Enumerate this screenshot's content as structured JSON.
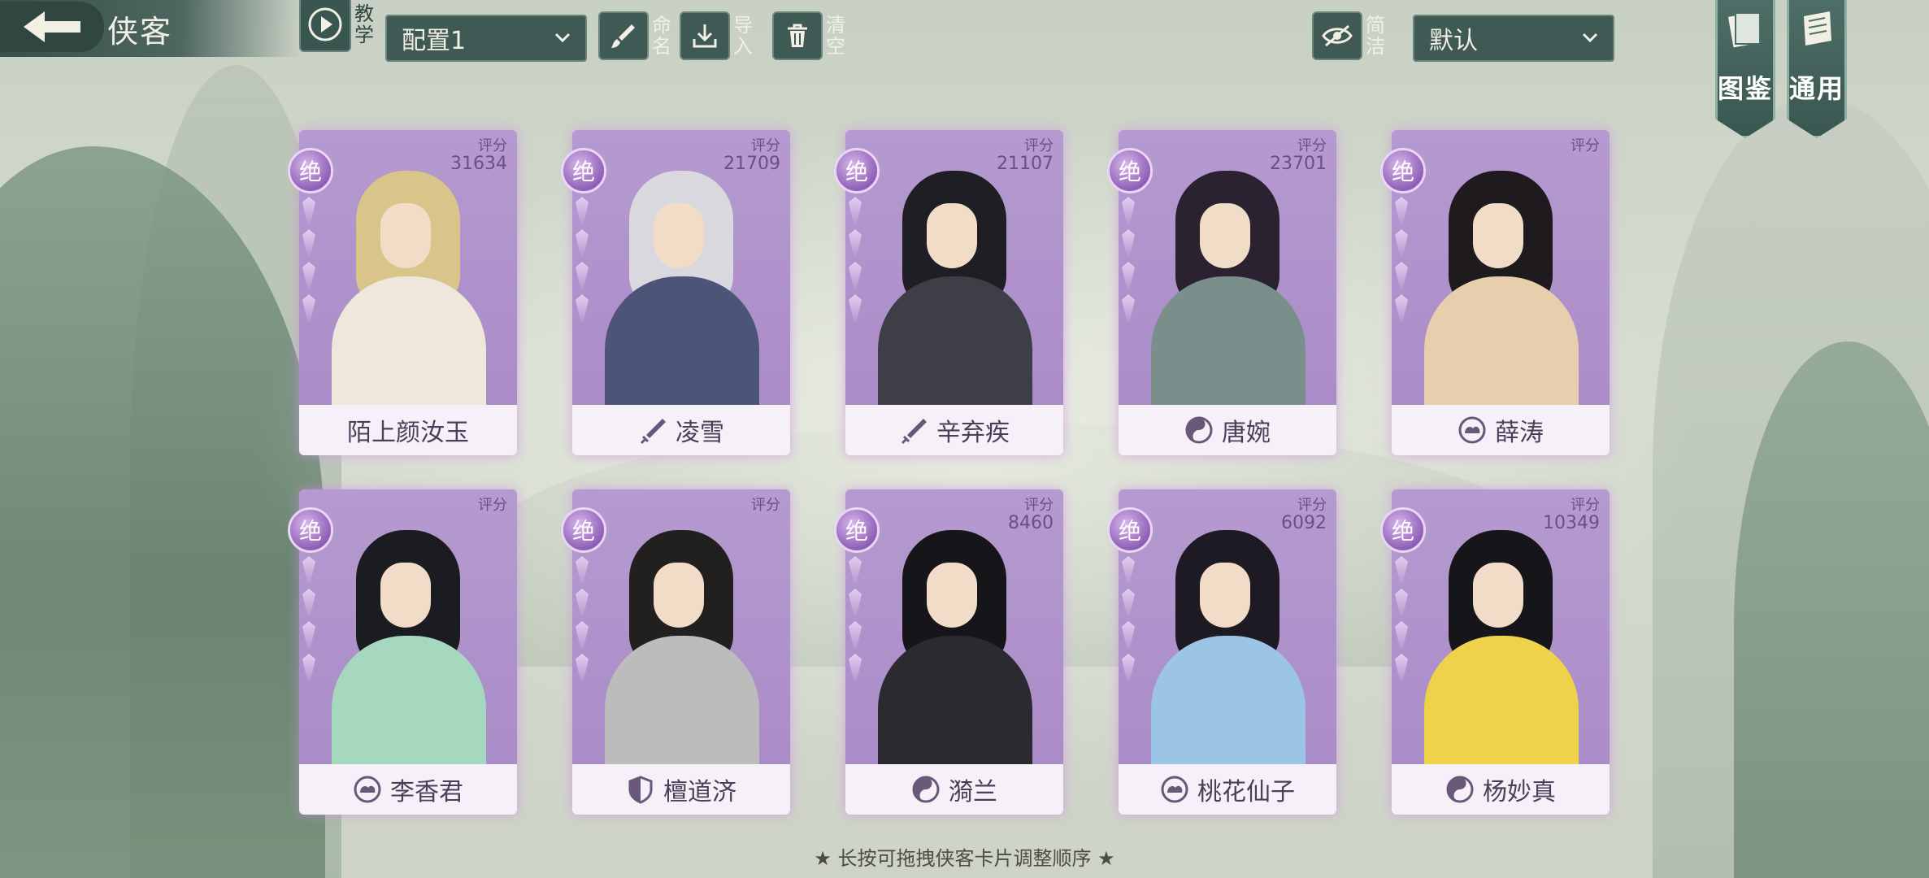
{
  "header": {
    "title": "侠客"
  },
  "toolbar": {
    "tutorial_label": "教学",
    "config_select": "配置1",
    "rename_label": "命名",
    "import_label": "导入",
    "clear_label": "清空",
    "simple_label": "简洁",
    "sort_select": "默认"
  },
  "side_tabs": [
    {
      "label": "图鉴"
    },
    {
      "label": "通用"
    }
  ],
  "cards": [
    {
      "name": "陌上颜汝玉",
      "score_label": "评分",
      "score": "31634",
      "rank": "绝",
      "sect_icon": "none",
      "hair": "#d9c489",
      "robe": "#efe6dc"
    },
    {
      "name": "凌雪",
      "score_label": "评分",
      "score": "21709",
      "rank": "绝",
      "sect_icon": "sword-icon",
      "hair": "#d8d8de",
      "robe": "#4c5578"
    },
    {
      "name": "辛弃疾",
      "score_label": "评分",
      "score": "21107",
      "rank": "绝",
      "sect_icon": "sword-icon",
      "hair": "#1e1e24",
      "robe": "#3e3e46"
    },
    {
      "name": "唐婉",
      "score_label": "评分",
      "score": "23701",
      "rank": "绝",
      "sect_icon": "taiji-icon",
      "hair": "#2a2230",
      "robe": "#7a8f8c"
    },
    {
      "name": "薛涛",
      "score_label": "评分",
      "score": "",
      "rank": "绝",
      "sect_icon": "cloud-icon",
      "hair": "#1e1a1e",
      "robe": "#e7cfae"
    },
    {
      "name": "李香君",
      "score_label": "评分",
      "score": "",
      "rank": "绝",
      "sect_icon": "cloud-icon",
      "hair": "#1b1b22",
      "robe": "#a6d8c0"
    },
    {
      "name": "檀道济",
      "score_label": "评分",
      "score": "",
      "rank": "绝",
      "sect_icon": "shield-icon",
      "hair": "#22201e",
      "robe": "#bcbcbc"
    },
    {
      "name": "漪兰",
      "score_label": "评分",
      "score": "8460",
      "rank": "绝",
      "sect_icon": "taiji-icon",
      "hair": "#15151a",
      "robe": "#2a2a30"
    },
    {
      "name": "桃花仙子",
      "score_label": "评分",
      "score": "6092",
      "rank": "绝",
      "sect_icon": "cloud-icon",
      "hair": "#1e1a24",
      "robe": "#9cc4e4"
    },
    {
      "name": "杨妙真",
      "score_label": "评分",
      "score": "10349",
      "rank": "绝",
      "sect_icon": "taiji-icon",
      "hair": "#15151a",
      "robe": "#eed24a"
    }
  ],
  "hint": "★ 长按可拖拽侠客卡片调整顺序 ★"
}
